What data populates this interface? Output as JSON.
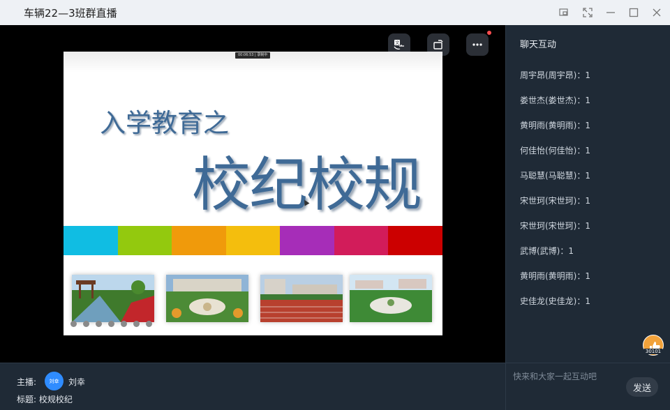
{
  "window": {
    "title": "车辆22—3班群直播"
  },
  "slide": {
    "recording_badge": "00:06:53 | 录制中",
    "heading_small": "入学教育之",
    "heading_large": "校纪校规",
    "stripe_colors": [
      "#10bde3",
      "#93c90e",
      "#f09a0b",
      "#f4be0d",
      "#a62db8",
      "#d21c5a",
      "#cc0000"
    ]
  },
  "bottom": {
    "host_label": "主播:",
    "host_avatar": "刘幸",
    "host_name": "刘幸",
    "subject": "标题: 校规校纪"
  },
  "chat": {
    "title": "聊天互动",
    "messages": [
      "周宇昂(周宇昂)：1",
      "娄世杰(娄世杰)：1",
      "黄明雨(黄明雨)：1",
      "何佳怡(何佳怡)：1",
      "马聪慧(马聪慧)：1",
      "宋世珂(宋世珂)：1",
      "宋世珂(宋世珂)：1",
      "武博(武博)：1",
      "黄明雨(黄明雨)：1",
      "史佳龙(史佳龙)：1"
    ],
    "like_count": "30101",
    "input_placeholder": "快来和大家一起互动吧",
    "send_label": "发送"
  }
}
